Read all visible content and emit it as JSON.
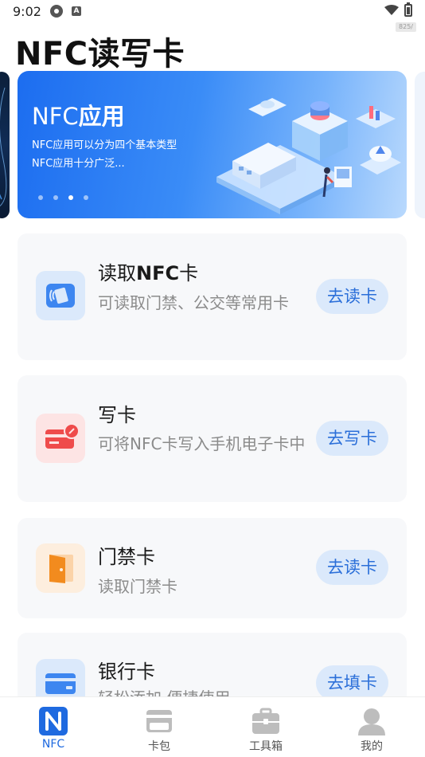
{
  "status_bar": {
    "time": "9:02",
    "badge": "825/"
  },
  "page": {
    "title": "NFC读写卡"
  },
  "banner": {
    "title_prefix": "NFC",
    "title_suffix": "应用",
    "line1": "NFC应用可以分为四个基本类型",
    "line2": "NFC应用十分广泛...",
    "dots_total": 4,
    "active_dot": 3
  },
  "cards": [
    {
      "title_prefix": "读取",
      "title_bold": "NFC",
      "title_suffix": "卡",
      "desc": "可读取门禁、公交等常用卡",
      "button": "去读卡",
      "icon": "nfc-read-icon",
      "icon_color": "#3d86f0"
    },
    {
      "title": "写卡",
      "desc": "可将NFC卡写入手机电子卡中",
      "button": "去写卡",
      "icon": "card-write-icon",
      "icon_color": "#ef4b4b"
    },
    {
      "title": "门禁卡",
      "desc": "读取门禁卡",
      "button": "去读卡",
      "icon": "door-icon",
      "icon_color": "#f28b1e"
    },
    {
      "title": "银行卡",
      "desc": "轻松添加 便捷使用",
      "button": "去填卡",
      "icon": "bank-card-icon",
      "icon_color": "#3d86f0"
    }
  ],
  "bottom_nav": [
    {
      "label": "NFC",
      "icon": "nfc-icon",
      "active": true
    },
    {
      "label": "卡包",
      "icon": "wallet-icon",
      "active": false
    },
    {
      "label": "工具箱",
      "icon": "toolbox-icon",
      "active": false
    },
    {
      "label": "我的",
      "icon": "profile-icon",
      "active": false
    }
  ],
  "colors": {
    "accent": "#1f6ae0",
    "button_bg": "#dbe9fb",
    "card_bg": "#f7f8fa"
  }
}
